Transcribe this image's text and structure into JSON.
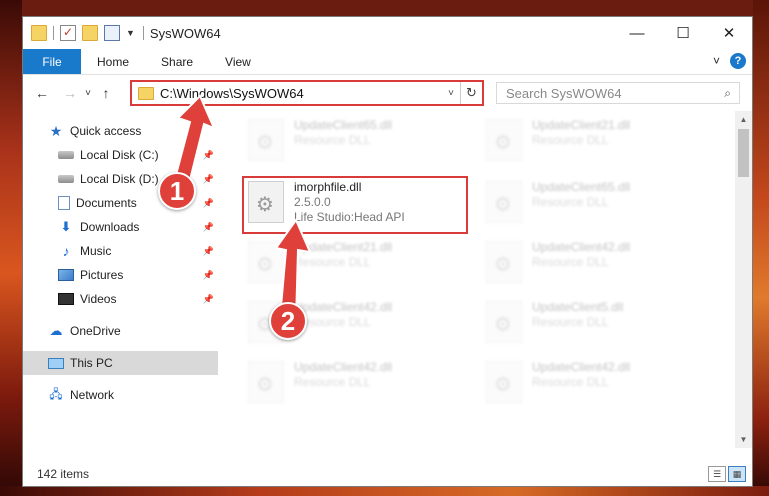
{
  "window": {
    "title": "SysWOW64",
    "minimize": "—",
    "maximize": "☐",
    "close": "✕"
  },
  "ribbon": {
    "tabs": [
      "File",
      "Home",
      "Share",
      "View"
    ],
    "expand_icon": "˅",
    "help_icon": "?"
  },
  "nav": {
    "back": "←",
    "forward": "→",
    "recent": "˅",
    "up": "↑",
    "address": "C:\\Windows\\SysWOW64",
    "address_dropdown": "˅",
    "refresh": "↻",
    "search_placeholder": "Search SysWOW64",
    "search_icon": "⌕"
  },
  "sidebar": {
    "items": [
      {
        "label": "Quick access",
        "icon": "star-icon"
      },
      {
        "label": "Local Disk (C:)",
        "icon": "disk-icon",
        "pinned": true
      },
      {
        "label": "Local Disk (D:)",
        "icon": "disk-icon",
        "pinned": true
      },
      {
        "label": "Documents",
        "icon": "documents-icon",
        "pinned": true
      },
      {
        "label": "Downloads",
        "icon": "downloads-icon",
        "pinned": true
      },
      {
        "label": "Music",
        "icon": "music-icon",
        "pinned": true
      },
      {
        "label": "Pictures",
        "icon": "pictures-icon",
        "pinned": true
      },
      {
        "label": "Videos",
        "icon": "videos-icon",
        "pinned": true
      },
      {
        "label": "OneDrive",
        "icon": "onedrive-icon"
      },
      {
        "label": "This PC",
        "icon": "this-pc-icon",
        "selected": true
      },
      {
        "label": "Network",
        "icon": "network-icon"
      }
    ],
    "pin_glyph": "📌"
  },
  "files": {
    "left": [
      {
        "name": "UpdateClient65.dll",
        "sub": "Resource DLL",
        "blurred": true
      },
      {
        "name": "imorphfile.dll",
        "sub": "2.5.0.0",
        "sub2": "Life Studio:Head API",
        "blurred": false
      },
      {
        "name": "UpdateClient21.dll",
        "sub": "Resource DLL",
        "blurred": true
      },
      {
        "name": "UpdateClient42.dll",
        "sub": "Resource DLL",
        "blurred": true
      },
      {
        "name": "UpdateClient42.dll",
        "sub": "Resource DLL",
        "blurred": true
      }
    ],
    "right": [
      {
        "name": "UpdateClient21.dll",
        "sub": "Resource DLL"
      },
      {
        "name": "UpdateClient65.dll",
        "sub": "Resource DLL"
      },
      {
        "name": "UpdateClient42.dll",
        "sub": "Resource DLL"
      },
      {
        "name": "UpdateClient5.dll",
        "sub": "Resource DLL"
      },
      {
        "name": "UpdateClient42.dll",
        "sub": "Resource DLL"
      }
    ]
  },
  "status": {
    "item_count": "142 items"
  },
  "annotations": {
    "step1": "1",
    "step2": "2",
    "color": "#e0403a"
  },
  "colors": {
    "file_tab": "#1979ca",
    "highlight": "#d93a3a"
  }
}
